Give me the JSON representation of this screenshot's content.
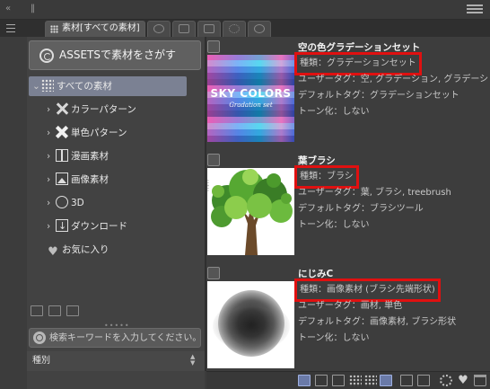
{
  "panel": {
    "tab_active_label": "素材[すべての素材]",
    "tab_icons": [
      "brush-tab-icon",
      "layer-tab-icon",
      "navigator-tab-icon",
      "settings-tab-icon",
      "info-tab-icon"
    ]
  },
  "assets_button": {
    "label": "ASSETSで素材をさがす"
  },
  "tree": {
    "items": [
      {
        "label": "すべての素材",
        "icon": "grid-icon",
        "expanded": true,
        "selected": true
      },
      {
        "label": "カラーパターン",
        "icon": "crossed-brushes-icon"
      },
      {
        "label": "単色パターン",
        "icon": "crossed-tools-icon"
      },
      {
        "label": "漫画素材",
        "icon": "manga-icon"
      },
      {
        "label": "画像素材",
        "icon": "image-icon"
      },
      {
        "label": "3D",
        "icon": "cube-icon"
      },
      {
        "label": "ダウンロード",
        "icon": "download-icon"
      },
      {
        "label": "お気に入り",
        "icon": "heart-icon"
      }
    ]
  },
  "search": {
    "placeholder": "検索キーワードを入力してください。"
  },
  "kind_filter": {
    "label": "種別"
  },
  "materials": [
    {
      "name": "空の色グラデーションセット",
      "kind": "種類：グラデーションセット",
      "user_tags": "ユーザータグ：空, グラデーション, グラデーションマップ",
      "default_tags": "デフォルトタグ：グラデーションセット",
      "tone": "トーン化：しない",
      "thumb_text": "SKY COLORS",
      "thumb_subtext": "Gradation set"
    },
    {
      "name": "葉ブラシ",
      "kind": "種類：ブラシ",
      "user_tags": "ユーザータグ：葉, ブラシ, treebrush",
      "default_tags": "デフォルトタグ：ブラシツール",
      "tone": "トーン化：しない"
    },
    {
      "name": "にじみC",
      "kind": "種類：画像素材 (ブラシ先端形状)",
      "user_tags": "ユーザータグ：画材, 単色",
      "default_tags": "デフォルトタグ：画像素材, ブラシ形状",
      "tone": "トーン化：しない"
    }
  ],
  "colors": {
    "highlight_box": "#e01010",
    "selected_row": "#7b8193"
  },
  "bottom_toolbar": [
    "thumbnail-view-icon",
    "detail-view-icon",
    "list-view-icon",
    "grid-small-icon",
    "grid-large-icon",
    "detail-list-icon",
    "paste-icon",
    "import-icon",
    "properties-icon",
    "favorite-icon",
    "delete-icon"
  ]
}
